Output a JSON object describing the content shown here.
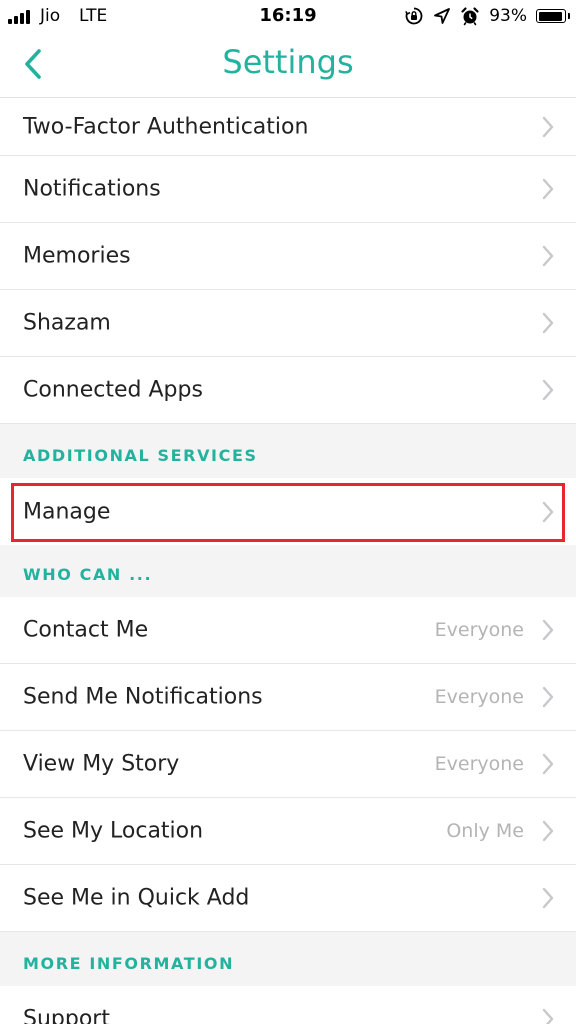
{
  "status_bar": {
    "carrier": "Jio",
    "network": "LTE",
    "time": "16:19",
    "battery_percent": "93%",
    "battery_level": 0.93,
    "icons": [
      "orientation-lock-icon",
      "location-arrow-icon",
      "alarm-icon"
    ]
  },
  "nav": {
    "title": "Settings",
    "back_icon": "chevron-left-icon"
  },
  "theme": {
    "accent": "#23b29e",
    "highlight": "#e8262f",
    "value_text": "#b4b4b4"
  },
  "rows_top": [
    {
      "label": "Two-Factor Authentication"
    },
    {
      "label": "Notifications"
    },
    {
      "label": "Memories"
    },
    {
      "label": "Shazam"
    },
    {
      "label": "Connected Apps"
    }
  ],
  "section_additional": {
    "title": "ADDITIONAL SERVICES",
    "rows": [
      {
        "label": "Manage"
      }
    ]
  },
  "section_who": {
    "title": "WHO CAN ...",
    "rows": [
      {
        "label": "Contact Me",
        "value": "Everyone"
      },
      {
        "label": "Send Me Notifications",
        "value": "Everyone"
      },
      {
        "label": "View My Story",
        "value": "Everyone"
      },
      {
        "label": "See My Location",
        "value": "Only Me"
      },
      {
        "label": "See Me in Quick Add",
        "value": ""
      }
    ]
  },
  "section_more": {
    "title": "MORE INFORMATION",
    "rows": [
      {
        "label": "Support"
      }
    ]
  }
}
